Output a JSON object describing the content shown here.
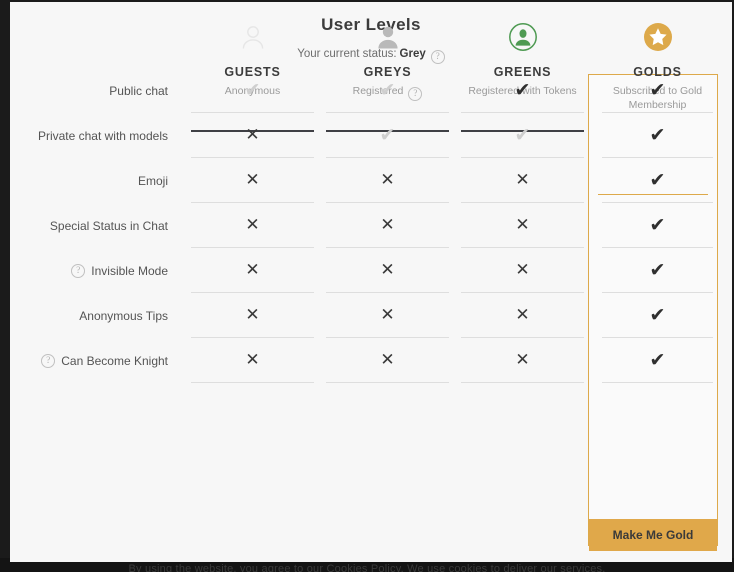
{
  "modal": {
    "title": "User Levels",
    "status_prefix": "Your current status:",
    "status_value": "Grey",
    "status_help_icon": "help-icon",
    "make_gold_label": "Make Me Gold"
  },
  "backdrop": {
    "cookie_notice": "By using the website, you agree to our Cookies Policy. We use cookies to deliver our services."
  },
  "columns": [
    {
      "key": "guests",
      "name": "GUESTS",
      "subtitle": "Anonymous",
      "icon": "person-outline-icon",
      "has_help": false,
      "highlighted": false,
      "accent": "#cfcfcf"
    },
    {
      "key": "greys",
      "name": "GREYS",
      "subtitle": "Registered",
      "icon": "person-solid-icon",
      "has_help": true,
      "highlighted": false,
      "accent": "#9a9a9a"
    },
    {
      "key": "greens",
      "name": "GREENS",
      "subtitle": "Registered with Tokens",
      "icon": "person-circle-green-icon",
      "has_help": false,
      "highlighted": false,
      "accent": "#4e9a52"
    },
    {
      "key": "golds",
      "name": "GOLDS",
      "subtitle": "Subscribed to Gold Membership",
      "icon": "star-circle-gold-icon",
      "has_help": false,
      "highlighted": true,
      "accent": "#dda94a"
    }
  ],
  "rows": [
    {
      "label": "Public chat",
      "help": false,
      "values": [
        "check-faint",
        "check-faint",
        "check-strong",
        "check-strong"
      ]
    },
    {
      "label": "Private chat with models",
      "help": false,
      "values": [
        "cross",
        "check-faint",
        "check-faint",
        "check-strong"
      ]
    },
    {
      "label": "Emoji",
      "help": false,
      "values": [
        "cross",
        "cross",
        "cross",
        "check-strong"
      ]
    },
    {
      "label": "Special Status in Chat",
      "help": false,
      "values": [
        "cross",
        "cross",
        "cross",
        "check-strong"
      ]
    },
    {
      "label": "Invisible Mode",
      "help": true,
      "values": [
        "cross",
        "cross",
        "cross",
        "check-strong"
      ]
    },
    {
      "label": "Anonymous Tips",
      "help": false,
      "values": [
        "cross",
        "cross",
        "cross",
        "check-strong"
      ]
    },
    {
      "label": "Can Become Knight",
      "help": true,
      "values": [
        "cross",
        "cross",
        "cross",
        "check-strong"
      ]
    }
  ],
  "glyphs": {
    "check": "✔",
    "cross": "✕",
    "question": "?"
  },
  "colors": {
    "gold": "#e0a84a",
    "gold_border": "#dda94a",
    "green": "#4e9a52",
    "modal_bg": "#f7f7f7",
    "text_dark": "#3c3c3c",
    "text_muted": "#9a9a9a"
  }
}
